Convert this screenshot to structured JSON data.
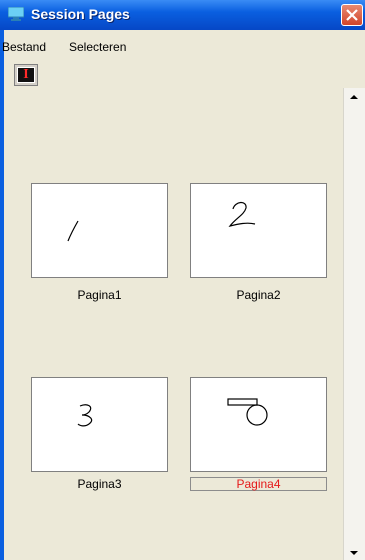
{
  "window": {
    "title": "Session Pages"
  },
  "menu": {
    "items": [
      "Bestand",
      "Selecteren"
    ]
  },
  "toolbar": {
    "icon": "text-i-icon",
    "glyph": "I"
  },
  "pages": [
    {
      "label": "Pagina1",
      "selected": false
    },
    {
      "label": "Pagina2",
      "selected": false
    },
    {
      "label": "Pagina3",
      "selected": false
    },
    {
      "label": "Pagina4",
      "selected": true
    }
  ],
  "colors": {
    "titlebar": "#0a5fe0",
    "selected_caption": "#e51a1a",
    "background": "#ece9d8"
  }
}
